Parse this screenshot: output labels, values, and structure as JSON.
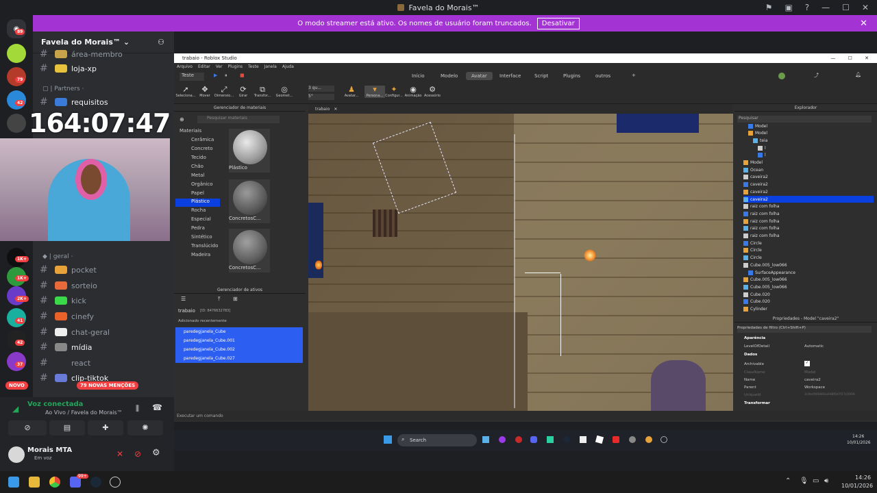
{
  "window": {
    "title": "Favela do Morais™"
  },
  "streamer_banner": {
    "text": "O modo streamer está ativo. Os nomes de usuário foram truncados.",
    "button": "Desativar"
  },
  "server": {
    "name": "Favela do Morais™"
  },
  "server_rail": {
    "badges": [
      "89",
      "79",
      "42",
      "1K+",
      "1K+",
      "2K+",
      "41",
      "42",
      "37"
    ]
  },
  "channels": {
    "top": [
      {
        "name": "área-membro"
      },
      {
        "name": "loja-xp"
      }
    ],
    "partners_label": "Partners",
    "partners": [
      {
        "name": "requisitos"
      }
    ],
    "timer": "164:07:47",
    "geral_label": "geral",
    "geral": [
      {
        "name": "pocket"
      },
      {
        "name": "sorteio"
      },
      {
        "name": "kick"
      },
      {
        "name": "cinefy"
      },
      {
        "name": "chat-geral"
      },
      {
        "name": "mídia"
      },
      {
        "name": "react"
      },
      {
        "name": "clip-tiktok"
      }
    ],
    "new_label": "NOVO",
    "mentions_label": "79 NOVAS MENÇÕES"
  },
  "voice": {
    "status": "Voz conectada",
    "channel": "Ao Vivo / Favela do Morais™"
  },
  "user": {
    "name": "Morais MTA",
    "status": "Em voz"
  },
  "studio": {
    "title": "trabaio - Roblox Studio",
    "menu": [
      "Arquivo",
      "Editar",
      "Ver",
      "Plugins",
      "Teste",
      "Janela",
      "Ajuda"
    ],
    "mode": "Teste",
    "tabs": [
      "Início",
      "Modelo",
      "Avatar",
      "Interface",
      "Script",
      "Plugins",
      "outros"
    ],
    "active_tab": "Avatar",
    "tools": [
      "Seleciona...",
      "Mover",
      "Dimensio...",
      "Girar",
      "Transfor...",
      "Geomet...",
      "Avatar...",
      "Persona...",
      "Configur...",
      "Animação",
      "Acessório"
    ],
    "step_values": [
      "3 qu...",
      "5°"
    ],
    "material_manager": {
      "title": "Gerenciador de materiais",
      "search_placeholder": "Pesquisar materiais",
      "root": "Materiais",
      "categories": [
        "Cerâmica",
        "Concreto",
        "Tecido",
        "Chão",
        "Metal",
        "Orgânico",
        "Papel",
        "Plástico",
        "Rocha",
        "Especial",
        "Pedra",
        "Sintético",
        "Translúcido",
        "Madeira"
      ],
      "selected": "Plástico",
      "swatches": [
        "Plástico",
        "ConcretosC...",
        "ConcretosC..."
      ]
    },
    "asset_manager": {
      "title": "Gerenciador de ativos",
      "place": "trabaio",
      "place_id": "[ID: 8476632783]",
      "section": "Adicionado recentemente",
      "items": [
        "paredegjanela_Cube",
        "paredegjanela_Cube.001",
        "paredegjanela_Cube.002",
        "paredegjanela_Cube.027"
      ]
    },
    "viewport_tab": "trabaio",
    "explorer": {
      "title": "Explorador",
      "search": "Pesquisar",
      "items": [
        {
          "name": "Model",
          "indent": 2
        },
        {
          "name": "Model",
          "indent": 2
        },
        {
          "name": "teia",
          "indent": 3
        },
        {
          "name": "l",
          "indent": 4
        },
        {
          "name": "l",
          "indent": 4
        },
        {
          "name": "Model",
          "indent": 1
        },
        {
          "name": "Ocean",
          "indent": 1
        },
        {
          "name": "caveira2",
          "indent": 1
        },
        {
          "name": "caveira2",
          "indent": 1
        },
        {
          "name": "caveira2",
          "indent": 1
        },
        {
          "name": "caveira2",
          "indent": 1,
          "selected": true
        },
        {
          "name": "raiz com folha",
          "indent": 1
        },
        {
          "name": "raiz com folha",
          "indent": 1
        },
        {
          "name": "raiz com folha",
          "indent": 1
        },
        {
          "name": "raiz com folha",
          "indent": 1
        },
        {
          "name": "raiz com folha",
          "indent": 1
        },
        {
          "name": "Circle",
          "indent": 1
        },
        {
          "name": "Circle",
          "indent": 1
        },
        {
          "name": "Circle",
          "indent": 1
        },
        {
          "name": "Cube.005_low066",
          "indent": 1
        },
        {
          "name": "SurfaceAppearance",
          "indent": 2
        },
        {
          "name": "Cube.005_low066",
          "indent": 1
        },
        {
          "name": "Cube.005_low066",
          "indent": 1
        },
        {
          "name": "Cube.020",
          "indent": 1
        },
        {
          "name": "Cube.020",
          "indent": 1
        },
        {
          "name": "Cylinder",
          "indent": 1
        }
      ]
    },
    "properties": {
      "title": "Propriedades - Model \"caveira2\"",
      "filter": "Propriedades de filtro (Ctrl+Shift+P)",
      "sections": [
        "Aparência",
        "Dados",
        "Transformar"
      ],
      "rows": [
        {
          "key": "LevelOfDetail",
          "value": "Automatic"
        },
        {
          "key": "Archivable",
          "value": "✓"
        },
        {
          "key": "ClassName",
          "value": "Model"
        },
        {
          "key": "Name",
          "value": "caveira2"
        },
        {
          "key": "Parent",
          "value": "Workspace"
        },
        {
          "key": "UniqueId",
          "value": "3c9e4900866a0d8f0d7f17c0006"
        }
      ]
    },
    "command_placeholder": "Executar um comando"
  },
  "inner_taskbar": {
    "search": "Search",
    "time": "14:26",
    "date": "10/01/2026"
  },
  "taskbar": {
    "time": "14:26",
    "date": "10/01/2026",
    "discord_badge": "99+"
  }
}
